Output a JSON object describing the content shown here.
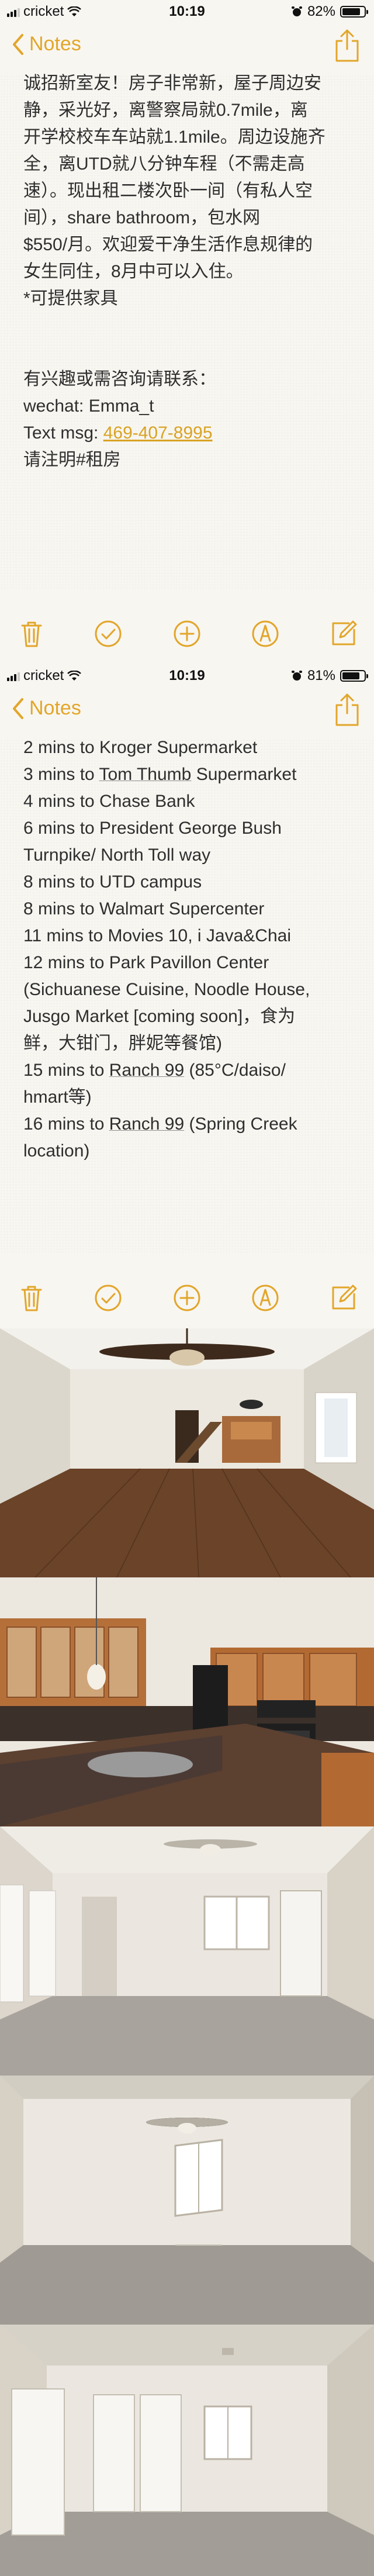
{
  "status_bar_1": {
    "carrier": "cricket",
    "time": "10:19",
    "battery": "82%",
    "battery_level": 0.82
  },
  "status_bar_2": {
    "carrier": "cricket",
    "time": "10:19",
    "battery": "81%",
    "battery_level": 0.81
  },
  "nav": {
    "back_label": "Notes"
  },
  "note_part1": {
    "lines": [
      "诚招新室友！房子非常新，屋子周边安",
      "静，采光好，离警察局就0.7mile，离",
      "开学校校车车站就1.1mile。周边设施齐",
      "全，离UTD就八分钟车程（不需走高",
      "速）。现出租二楼次卧一间（有私人空",
      "间），share bathroom，包水网",
      "$550/月。欢迎爱干净生活作息规律的",
      "女生同住，8月中可以入住。",
      "*可提供家具"
    ],
    "contact_intro": "有兴趣或需咨询请联系：",
    "wechat": "wechat: Emma_t",
    "text_prefix": "Text msg: ",
    "phone": "469-407-8995",
    "note": "请注明#租房"
  },
  "note_part2": {
    "l1": "2 mins to Kroger Supermarket",
    "l2_pre": "3 mins to ",
    "l2_link": "Tom Thumb",
    "l2_post": " Supermarket",
    "l3": "4 mins to Chase Bank",
    "l4": "6 mins to President George Bush",
    "l5": "Turnpike/ North Toll way",
    "l6": "8 mins to UTD campus",
    "l7": "8 mins to Walmart Supercenter",
    "l8": "11 mins to Movies 10, i Java&Chai",
    "l9": "12 mins to Park Pavillon Center",
    "l10": "(Sichuanese Cuisine, Noodle House,",
    "l11": "Jusgo Market [coming soon]，食为",
    "l12": "鲜，大钳门，胖妮等餐馆)",
    "l13_pre": "15 mins to ",
    "l13_link": "Ranch 99",
    "l13_post": " (85°C/daiso/",
    "l14": "hmart等)",
    "l15_pre": "16 mins to ",
    "l15_link": "Ranch 99",
    "l15_post": " (Spring Creek",
    "l16": "location)"
  },
  "toolbar": {
    "icons": [
      "trash-icon",
      "checklist-icon",
      "add-icon",
      "markup-icon",
      "compose-icon"
    ],
    "accent": "#e2a62a"
  },
  "photos": [
    "living-room-photo",
    "kitchen-photo",
    "bedroom-photo-1",
    "bedroom-photo-2",
    "bedroom-photo-3"
  ]
}
